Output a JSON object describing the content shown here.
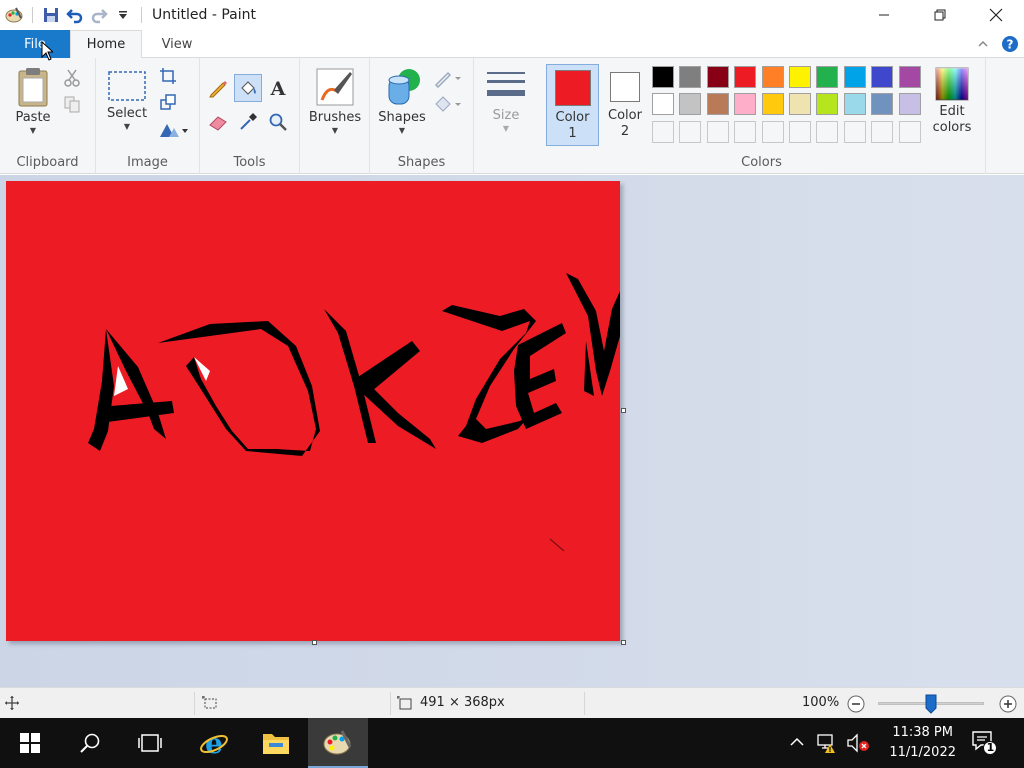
{
  "window": {
    "title": "Untitled - Paint"
  },
  "tabs": {
    "file": "File",
    "home": "Home",
    "view": "View"
  },
  "ribbon": {
    "clipboard": {
      "paste": "Paste",
      "group": "Clipboard"
    },
    "image": {
      "select": "Select",
      "group": "Image"
    },
    "tools": {
      "group": "Tools"
    },
    "brushes": {
      "label": "Brushes"
    },
    "shapes": {
      "label": "Shapes",
      "group": "Shapes"
    },
    "size": {
      "label": "Size"
    },
    "color1": {
      "line1": "Color",
      "line2": "1",
      "value": "#ed1c24"
    },
    "color2": {
      "line1": "Color",
      "line2": "2",
      "value": "#ffffff"
    },
    "colors": {
      "group": "Colors",
      "edit_line1": "Edit",
      "edit_line2": "colors",
      "row1": [
        "#000000",
        "#7f7f7f",
        "#880015",
        "#ed1c24",
        "#ff7f27",
        "#fff200",
        "#22b14c",
        "#00a2e8",
        "#3f48cc",
        "#a349a4"
      ],
      "row2": [
        "#ffffff",
        "#c3c3c3",
        "#b97a57",
        "#ffaec9",
        "#ffc90e",
        "#efe4b0",
        "#b5e61d",
        "#99d9ea",
        "#7092be",
        "#c8bfe7"
      ]
    }
  },
  "canvas": {
    "background": "#ed1c24"
  },
  "status": {
    "size": "491 × 368px",
    "zoom": "100%",
    "zoom_slider_fraction": 0.5
  },
  "taskbar": {
    "time": "11:38 PM",
    "date": "11/1/2022",
    "notifications": "1"
  }
}
